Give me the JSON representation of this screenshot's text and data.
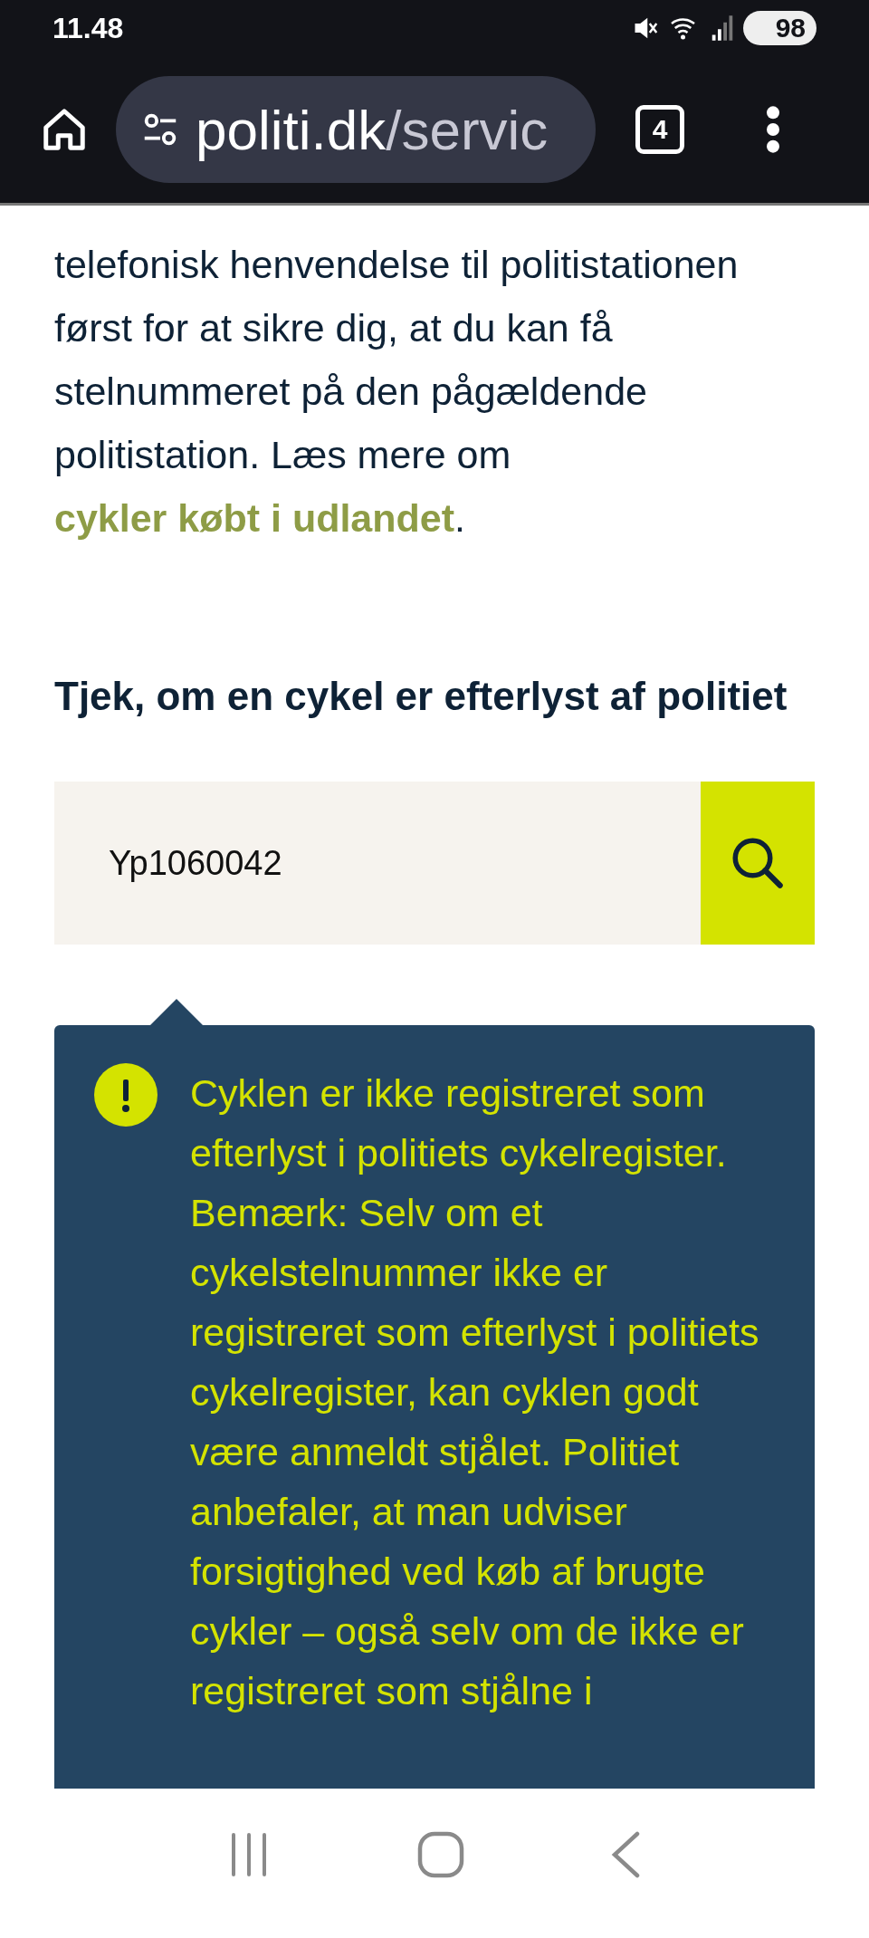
{
  "status_bar": {
    "time": "11.48",
    "battery": "98"
  },
  "browser": {
    "url_host": "politi.dk",
    "url_path": "/servic",
    "tab_count": "4"
  },
  "intro": "telefonisk henvendelse til politistationen først for at sikre dig, at du kan få stelnummeret på den pågældende politistation. Læs mere om ",
  "intro_link": "cykler købt i udlandet",
  "intro_end": ".",
  "heading": "Tjek, om en cykel er efterlyst af politiet",
  "search": {
    "value": "Yp1060042"
  },
  "alert": {
    "text": "Cyklen er ikke registreret som efterlyst i politiets cykelregister. Bemærk: Selv om et cykelstelnummer ikke er registreret som efterlyst i politiets cykelregister, kan cyklen godt være anmeldt stjålet. Politiet anbefaler, at man udviser forsigtighed ved køb af brugte cykler – også selv om de ikke er registreret som stjålne i"
  }
}
